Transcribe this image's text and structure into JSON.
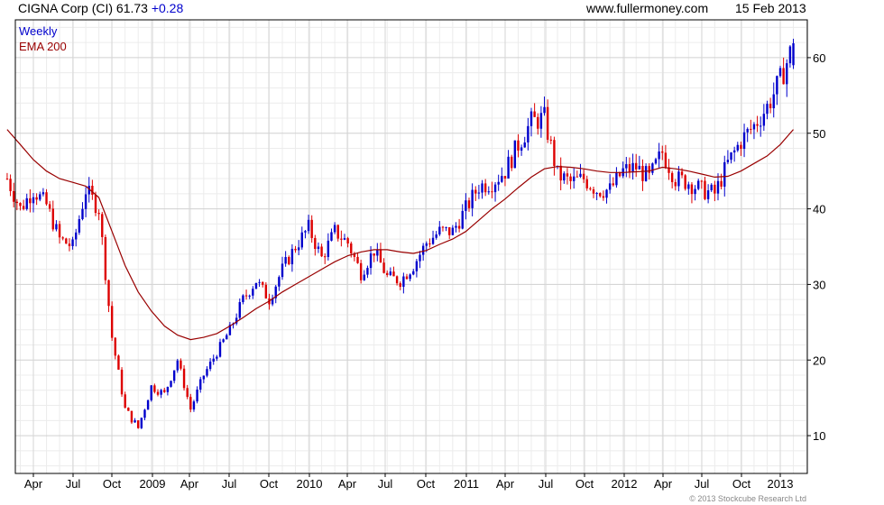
{
  "header": {
    "ticker_text": "CIGNA Corp (CI) 61.73",
    "change_text": "+0.28",
    "change_color": "#0000cc",
    "site": "www.fullermoney.com",
    "date": "15 Feb 2013"
  },
  "legend": {
    "series1_label": "Weekly",
    "series1_color": "#0000cc",
    "series2_label": "EMA 200",
    "series2_color": "#990000"
  },
  "footer": {
    "copyright": "© 2013 Stockcube Research Ltd"
  },
  "chart_data": {
    "type": "line",
    "y_ticks": [
      10,
      20,
      30,
      40,
      50,
      60
    ],
    "ylim": [
      5,
      65
    ],
    "x_ticks": [
      "Apr",
      "Jul",
      "Oct",
      "2009",
      "Apr",
      "Jul",
      "Oct",
      "2010",
      "Apr",
      "Jul",
      "Oct",
      "2011",
      "Apr",
      "Jul",
      "Oct",
      "2012",
      "Apr",
      "Jul",
      "Oct",
      "2013"
    ],
    "grid": true,
    "y_axis_side": "right",
    "legend_position": "top-left",
    "series": [
      {
        "name": "Weekly",
        "style": "candlestick",
        "up_color": "#0000cc",
        "down_color": "#dd0000",
        "points": [
          [
            "Feb 2008",
            44.0
          ],
          [
            "Mar 2008",
            40.0
          ],
          [
            "Apr 2008",
            42.5
          ],
          [
            "May 2008",
            40.5
          ],
          [
            "Jun 2008",
            36.0
          ],
          [
            "Jul 2008",
            35.0
          ],
          [
            "Aug 2008",
            42.5
          ],
          [
            "Sep 2008",
            40.0
          ],
          [
            "Oct 2008",
            23.0
          ],
          [
            "Nov 2008",
            13.5
          ],
          [
            "Dec 2008",
            11.0
          ],
          [
            "Jan 2009",
            16.5
          ],
          [
            "Feb 2009",
            15.5
          ],
          [
            "Mar 2009",
            20.0
          ],
          [
            "Apr 2009",
            13.5
          ],
          [
            "May 2009",
            18.0
          ],
          [
            "Jun 2009",
            21.0
          ],
          [
            "Jul 2009",
            24.0
          ],
          [
            "Aug 2009",
            28.0
          ],
          [
            "Sep 2009",
            30.5
          ],
          [
            "Oct 2009",
            28.0
          ],
          [
            "Nov 2009",
            32.0
          ],
          [
            "Dec 2009",
            35.0
          ],
          [
            "Jan 2010",
            37.5
          ],
          [
            "Feb 2010",
            33.5
          ],
          [
            "Mar 2010",
            37.0
          ],
          [
            "Apr 2010",
            35.5
          ],
          [
            "May 2010",
            31.5
          ],
          [
            "Jun 2010",
            34.5
          ],
          [
            "Jul 2010",
            31.0
          ],
          [
            "Aug 2010",
            30.5
          ],
          [
            "Sep 2010",
            32.5
          ],
          [
            "Oct 2010",
            35.5
          ],
          [
            "Nov 2010",
            37.0
          ],
          [
            "Dec 2010",
            37.0
          ],
          [
            "Jan 2011",
            40.0
          ],
          [
            "Feb 2011",
            43.0
          ],
          [
            "Mar 2011",
            43.5
          ],
          [
            "Apr 2011",
            45.0
          ],
          [
            "May 2011",
            48.5
          ],
          [
            "Jun 2011",
            51.5
          ],
          [
            "Jul 2011",
            52.0
          ],
          [
            "Aug 2011",
            44.5
          ],
          [
            "Sep 2011",
            43.5
          ],
          [
            "Oct 2011",
            44.0
          ],
          [
            "Nov 2011",
            42.5
          ],
          [
            "Dec 2011",
            42.5
          ],
          [
            "Jan 2012",
            45.0
          ],
          [
            "Feb 2012",
            45.5
          ],
          [
            "Mar 2012",
            44.0
          ],
          [
            "Apr 2012",
            47.5
          ],
          [
            "May 2012",
            44.0
          ],
          [
            "Jun 2012",
            43.5
          ],
          [
            "Jul 2012",
            42.5
          ],
          [
            "Aug 2012",
            42.0
          ],
          [
            "Sep 2012",
            46.0
          ],
          [
            "Oct 2012",
            49.0
          ],
          [
            "Nov 2012",
            51.0
          ],
          [
            "Dec 2012",
            53.5
          ],
          [
            "Jan 2013",
            57.0
          ],
          [
            "Feb 2013",
            61.73
          ]
        ]
      },
      {
        "name": "EMA 200",
        "style": "line",
        "color": "#990000",
        "points": [
          [
            "Feb 2008",
            50.5
          ],
          [
            "Mar 2008",
            48.5
          ],
          [
            "Apr 2008",
            46.5
          ],
          [
            "May 2008",
            45.0
          ],
          [
            "Jun 2008",
            44.0
          ],
          [
            "Jul 2008",
            43.5
          ],
          [
            "Aug 2008",
            43.0
          ],
          [
            "Sep 2008",
            41.5
          ],
          [
            "Oct 2008",
            37.0
          ],
          [
            "Nov 2008",
            32.5
          ],
          [
            "Dec 2008",
            29.0
          ],
          [
            "Jan 2009",
            26.5
          ],
          [
            "Feb 2009",
            24.5
          ],
          [
            "Mar 2009",
            23.3
          ],
          [
            "Apr 2009",
            22.7
          ],
          [
            "May 2009",
            23.0
          ],
          [
            "Jun 2009",
            23.5
          ],
          [
            "Jul 2009",
            24.5
          ],
          [
            "Aug 2009",
            25.6
          ],
          [
            "Sep 2009",
            26.8
          ],
          [
            "Oct 2009",
            27.8
          ],
          [
            "Nov 2009",
            29.0
          ],
          [
            "Dec 2009",
            30.0
          ],
          [
            "Jan 2010",
            31.0
          ],
          [
            "Feb 2010",
            32.0
          ],
          [
            "Mar 2010",
            33.0
          ],
          [
            "Apr 2010",
            33.8
          ],
          [
            "May 2010",
            34.3
          ],
          [
            "Jun 2010",
            34.6
          ],
          [
            "Jul 2010",
            34.6
          ],
          [
            "Aug 2010",
            34.3
          ],
          [
            "Sep 2010",
            34.1
          ],
          [
            "Oct 2010",
            34.5
          ],
          [
            "Nov 2010",
            35.3
          ],
          [
            "Dec 2010",
            36.0
          ],
          [
            "Jan 2011",
            37.0
          ],
          [
            "Feb 2011",
            38.5
          ],
          [
            "Mar 2011",
            40.0
          ],
          [
            "Apr 2011",
            41.3
          ],
          [
            "May 2011",
            42.8
          ],
          [
            "Jun 2011",
            44.2
          ],
          [
            "Jul 2011",
            45.3
          ],
          [
            "Aug 2011",
            45.6
          ],
          [
            "Sep 2011",
            45.5
          ],
          [
            "Oct 2011",
            45.3
          ],
          [
            "Nov 2011",
            45.0
          ],
          [
            "Dec 2011",
            44.8
          ],
          [
            "Jan 2012",
            44.8
          ],
          [
            "Feb 2012",
            44.9
          ],
          [
            "Mar 2012",
            45.0
          ],
          [
            "Apr 2012",
            45.5
          ],
          [
            "May 2012",
            45.3
          ],
          [
            "Jun 2012",
            45.0
          ],
          [
            "Jul 2012",
            44.6
          ],
          [
            "Aug 2012",
            44.2
          ],
          [
            "Sep 2012",
            44.3
          ],
          [
            "Oct 2012",
            45.0
          ],
          [
            "Nov 2012",
            46.0
          ],
          [
            "Dec 2012",
            47.0
          ],
          [
            "Jan 2013",
            48.5
          ],
          [
            "Feb 2013",
            50.5
          ]
        ]
      }
    ]
  }
}
